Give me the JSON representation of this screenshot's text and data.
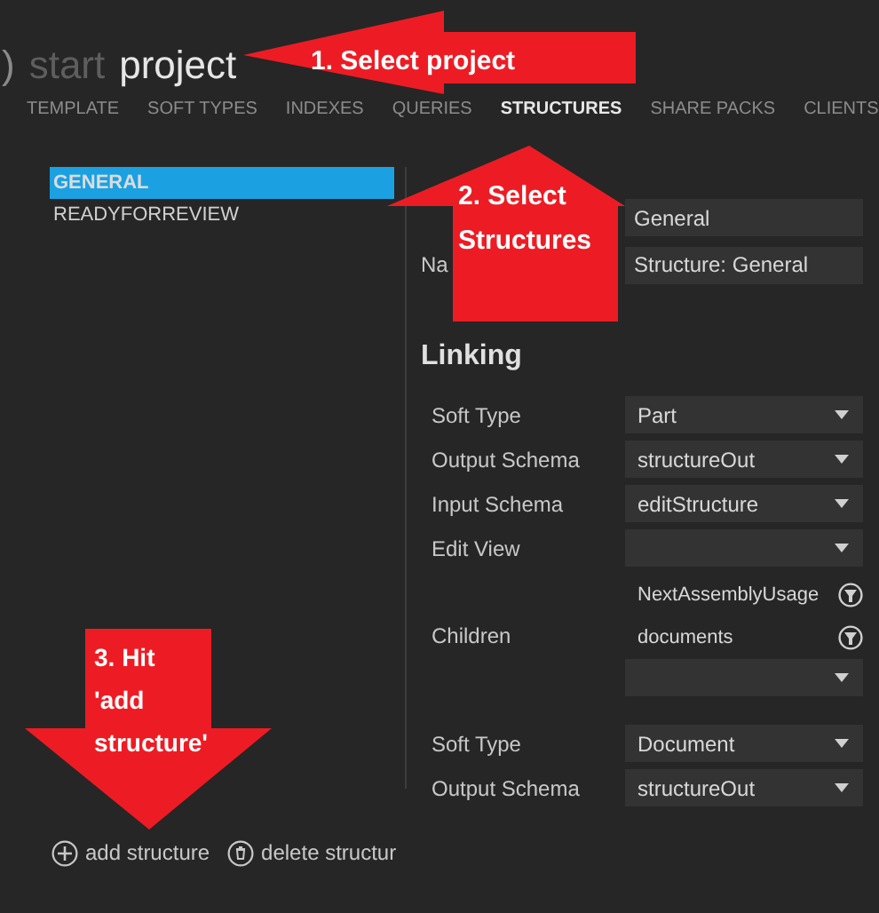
{
  "breadcrumb": {
    "back": ")",
    "start": "start",
    "current": "project"
  },
  "tabs": [
    {
      "label": "TEMPLATE",
      "selected": false
    },
    {
      "label": "SOFT TYPES",
      "selected": false
    },
    {
      "label": "INDEXES",
      "selected": false
    },
    {
      "label": "QUERIES",
      "selected": false
    },
    {
      "label": "STRUCTURES",
      "selected": true
    },
    {
      "label": "SHARE PACKS",
      "selected": false
    },
    {
      "label": "CLIENTS",
      "selected": false
    }
  ],
  "structures": [
    {
      "label": "GENERAL",
      "selected": true
    },
    {
      "label": "READYFORREVIEW",
      "selected": false
    }
  ],
  "fields": [
    {
      "value": "General"
    },
    {
      "label": "Na",
      "value": "Structure: General"
    }
  ],
  "linking": {
    "title": "Linking",
    "rows": [
      {
        "kind": "dropdown",
        "label": "Soft Type",
        "value": "Part"
      },
      {
        "kind": "dropdown",
        "label": "Output Schema",
        "value": "structureOut"
      },
      {
        "kind": "dropdown",
        "label": "Input Schema",
        "value": "editStructure"
      },
      {
        "kind": "dropdown",
        "label": "Edit View"
      },
      {
        "kind": "list",
        "label": "Children",
        "items": [
          "NextAssemblyUsage",
          "documents"
        ]
      },
      {
        "kind": "gap"
      },
      {
        "kind": "dropdown",
        "label": "Soft Type",
        "value": "Document"
      },
      {
        "kind": "dropdown",
        "label": "Output Schema",
        "value": "structureOut"
      }
    ]
  },
  "actions": [
    "add structure",
    "delete structur"
  ],
  "annotations": [
    {
      "kind": "left",
      "text": "1. Select project"
    },
    {
      "kind": "up",
      "text": "2. Select Structures"
    },
    {
      "kind": "down",
      "text": "3. Hit 'add structure'"
    }
  ]
}
